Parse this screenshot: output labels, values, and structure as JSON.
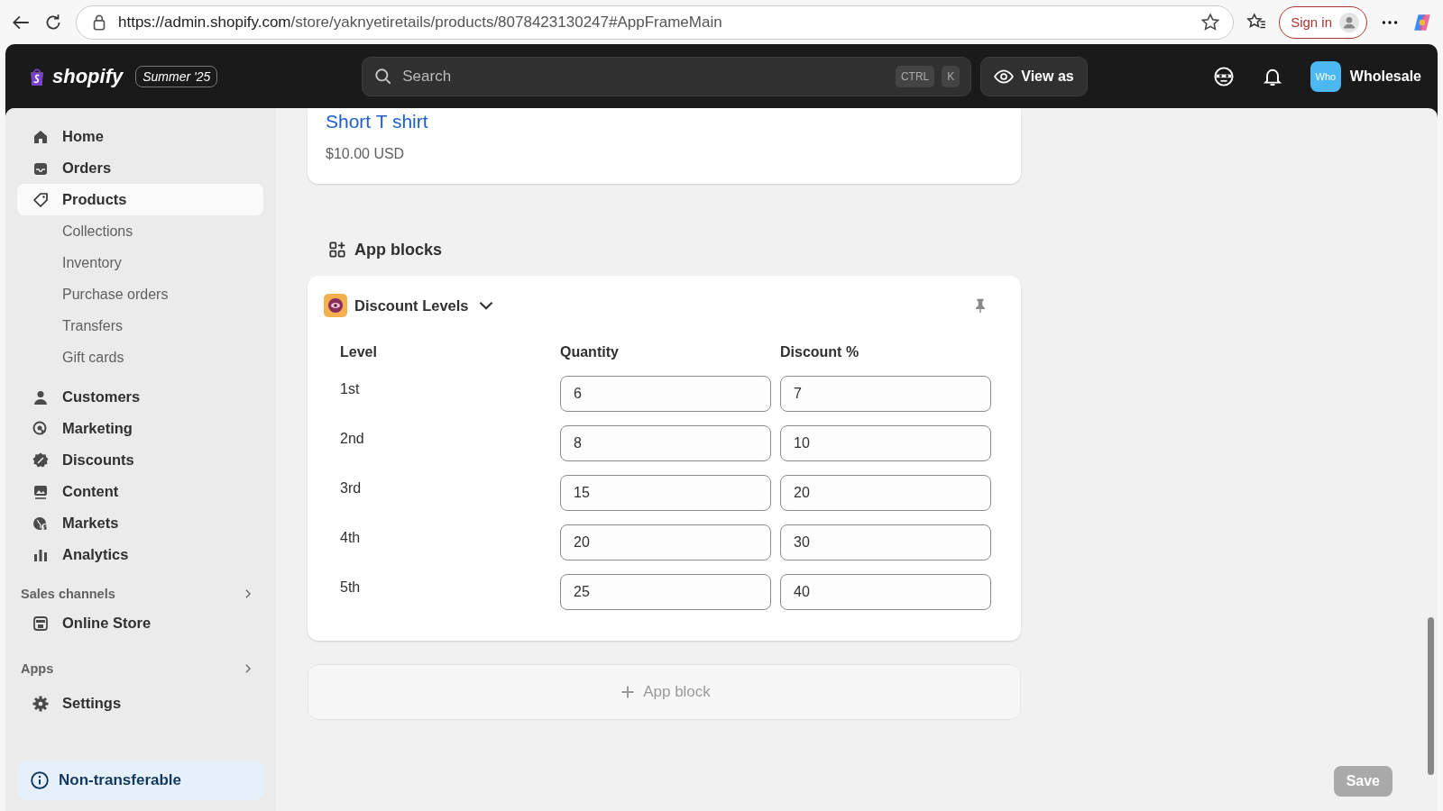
{
  "browser": {
    "url_host": "https://admin.shopify.com",
    "url_path": "/store/yaknyetiretails/products/8078423130247#AppFrameMain",
    "sign_in": "Sign in"
  },
  "topbar": {
    "logo": "shopify",
    "edition": "Summer '25",
    "search": {
      "placeholder": "Search",
      "keys": [
        "CTRL",
        "K"
      ]
    },
    "view_as": "View as",
    "avatar": "Who",
    "store": "Wholesale"
  },
  "sidebar": {
    "items": [
      {
        "label": "Home",
        "selected": false
      },
      {
        "label": "Orders",
        "selected": false
      },
      {
        "label": "Products",
        "selected": true,
        "children": [
          {
            "label": "Collections"
          },
          {
            "label": "Inventory"
          },
          {
            "label": "Purchase orders"
          },
          {
            "label": "Transfers"
          },
          {
            "label": "Gift cards"
          }
        ]
      },
      {
        "label": "Customers",
        "selected": false
      },
      {
        "label": "Marketing",
        "selected": false
      },
      {
        "label": "Discounts",
        "selected": false
      },
      {
        "label": "Content",
        "selected": false
      },
      {
        "label": "Markets",
        "selected": false
      },
      {
        "label": "Analytics",
        "selected": false
      }
    ],
    "sales_channels": {
      "heading": "Sales channels",
      "items": [
        {
          "label": "Online Store"
        }
      ]
    },
    "apps": {
      "heading": "Apps"
    },
    "settings": "Settings",
    "notice": "Non-transferable"
  },
  "product_card": {
    "title": "Short T shirt",
    "price": "$10.00 USD"
  },
  "app_blocks": {
    "heading": "App blocks",
    "block": {
      "title": "Discount Levels",
      "columns": [
        "Level",
        "Quantity",
        "Discount %"
      ],
      "rows": [
        {
          "level": "1st",
          "quantity": "6",
          "discount": "7"
        },
        {
          "level": "2nd",
          "quantity": "8",
          "discount": "10"
        },
        {
          "level": "3rd",
          "quantity": "15",
          "discount": "20"
        },
        {
          "level": "4th",
          "quantity": "20",
          "discount": "30"
        },
        {
          "level": "5th",
          "quantity": "25",
          "discount": "40"
        }
      ]
    },
    "add_button": "App block"
  },
  "save": {
    "label": "Save",
    "disabled": true
  }
}
